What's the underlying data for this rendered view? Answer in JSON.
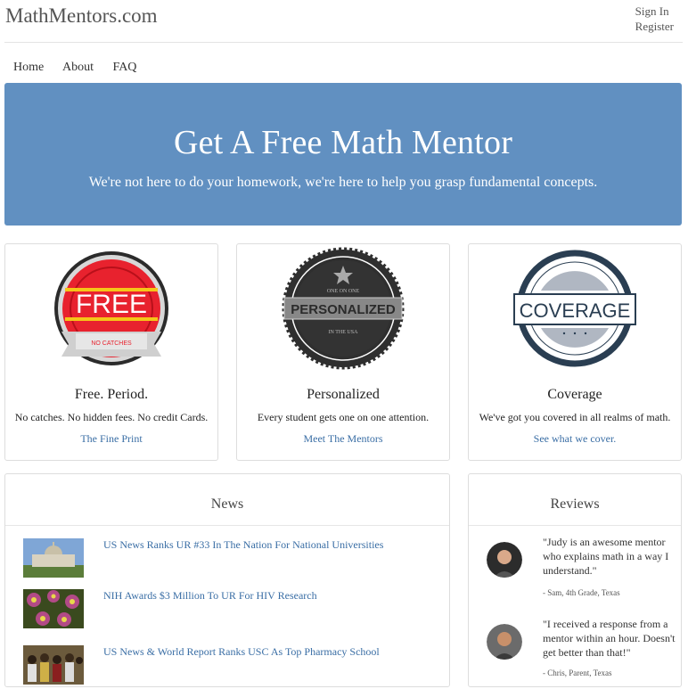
{
  "header": {
    "brand": "MathMentors.com",
    "sign_in": "Sign In",
    "register": "Register"
  },
  "nav": [
    "Home",
    "About",
    "FAQ"
  ],
  "hero": {
    "title": "Get A Free Math Mentor",
    "subtitle": "We're not here to do your homework, we're here to help you grasp fundamental concepts."
  },
  "features": [
    {
      "badge_main": "FREE",
      "badge_sub": "NO CATCHES",
      "title": "Free. Period.",
      "description": "No catches. No hidden fees. No credit Cards.",
      "link": "The Fine Print"
    },
    {
      "badge_main": "PERSONALIZED",
      "badge_top": "ONE ON ONE",
      "badge_bottom": "IN THE USA",
      "title": "Personalized",
      "description": "Every student gets one on one attention.",
      "link": "Meet The Mentors"
    },
    {
      "badge_main": "COVERAGE",
      "title": "Coverage",
      "description": "We've got you covered in all realms of math.",
      "link": "See what we cover."
    }
  ],
  "news": {
    "heading": "News",
    "items": [
      {
        "title": "US News Ranks UR #33 In The Nation For National Universities",
        "thumb_icon": "campus-building-photo"
      },
      {
        "title": "NIH Awards $3 Million To UR For HIV Research",
        "thumb_icon": "virus-cells-photo"
      },
      {
        "title": "US News & World Report Ranks USC As Top Pharmacy School",
        "thumb_icon": "students-group-photo"
      }
    ]
  },
  "reviews": {
    "heading": "Reviews",
    "items": [
      {
        "quote": "\"Judy is an awesome mentor who explains math in a way I understand.\"",
        "author": "- Sam, 4th Grade, Texas"
      },
      {
        "quote": "\"I received a response from a mentor within an hour. Doesn't get better than that!\"",
        "author": "- Chris, Parent, Texas"
      }
    ]
  },
  "colors": {
    "hero_bg": "#6190c1",
    "link": "#3a6ea5",
    "badge_red": "#e8222e"
  }
}
